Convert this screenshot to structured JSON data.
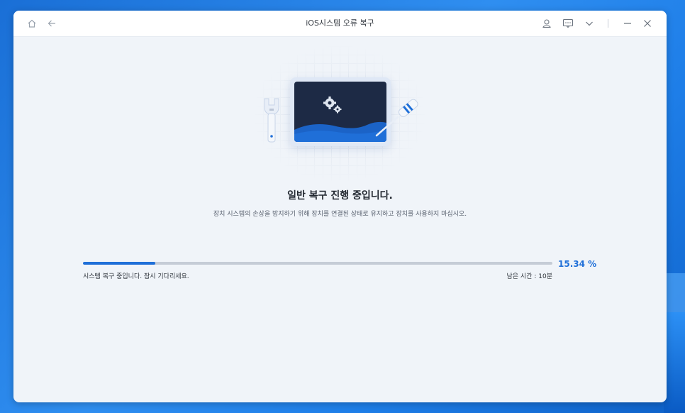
{
  "window": {
    "title": "iOS시스템 오류 복구",
    "icons": [
      "home-icon",
      "back-arrow-icon",
      "user-icon",
      "feedback-icon",
      "chevron-down-icon",
      "minimize-icon",
      "close-icon"
    ]
  },
  "main": {
    "heading": "일반 복구 진행 중입니다.",
    "subtext": "장치 시스템의 손상을 방지하기 위해 장치를 연결된 상태로 유지하고 장치를 사용하지 마십시오.",
    "progress": {
      "percent_text": "15.34 %",
      "fraction": 0.1534,
      "status_text": "시스템 복구 중입니다. 잠시 기다리세요.",
      "remaining_label": "남은 시간 :",
      "remaining_value": "10분"
    }
  },
  "colors": {
    "accent": "#1f6fd8",
    "screen": "#1d2a45",
    "window_bg": "#f0f4f9"
  }
}
